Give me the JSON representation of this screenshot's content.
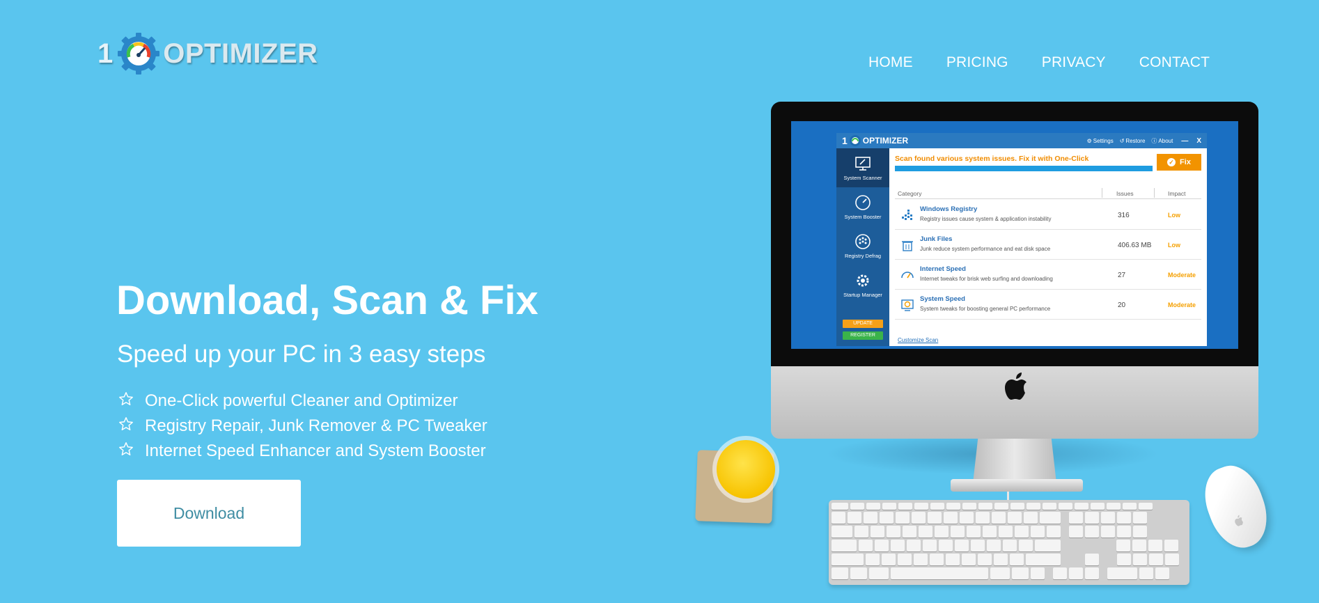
{
  "header": {
    "logo_number": "1",
    "logo_text": "OPTIMIZER",
    "nav": [
      {
        "label": "HOME"
      },
      {
        "label": "PRICING"
      },
      {
        "label": "PRIVACY"
      },
      {
        "label": "CONTACT"
      }
    ]
  },
  "hero": {
    "title": "Download, Scan & Fix",
    "subtitle": "Speed up your PC in 3 easy steps",
    "features": [
      "One-Click powerful Cleaner and Optimizer",
      "Registry Repair, Junk Remover & PC Tweaker",
      "Internet Speed Enhancer and System Booster"
    ],
    "download_label": "Download"
  },
  "app": {
    "title_number": "1",
    "title_name": "OPTIMIZER",
    "titlebar_items": [
      "Settings",
      "Restore",
      "About"
    ],
    "minimize": "—",
    "close": "X",
    "sidebar": [
      {
        "label": "System Scanner",
        "icon": "monitor-icon",
        "active": true
      },
      {
        "label": "System Booster",
        "icon": "speedometer-icon",
        "active": false
      },
      {
        "label": "Registry Defrag",
        "icon": "disk-icon",
        "active": false
      },
      {
        "label": "Startup Manager",
        "icon": "gear-icon",
        "active": false
      }
    ],
    "update_label": "UPDATE",
    "register_label": "REGISTER",
    "scan_message": "Scan found various system issues. Fix it with One-Click",
    "fix_label": "Fix",
    "columns": {
      "category": "Category",
      "issues": "Issues",
      "impact": "Impact"
    },
    "rows": [
      {
        "name": "Windows Registry",
        "desc": "Registry issues cause system & application instability",
        "issues": "316",
        "impact": "Low"
      },
      {
        "name": "Junk Files",
        "desc": "Junk reduce system performance and eat disk space",
        "issues": "406.63 MB",
        "impact": "Low"
      },
      {
        "name": "Internet Speed",
        "desc": "Internet tweaks for brisk web surfing and downloading",
        "issues": "27",
        "impact": "Moderate"
      },
      {
        "name": "System Speed",
        "desc": "System tweaks for boosting general PC performance",
        "issues": "20",
        "impact": "Moderate"
      }
    ],
    "customize_label": "Customize Scan"
  },
  "colors": {
    "background": "#5ac5ee",
    "accent_orange": "#f29300",
    "app_blue": "#2b7ac0",
    "sidebar_blue": "#1d5d9a"
  }
}
